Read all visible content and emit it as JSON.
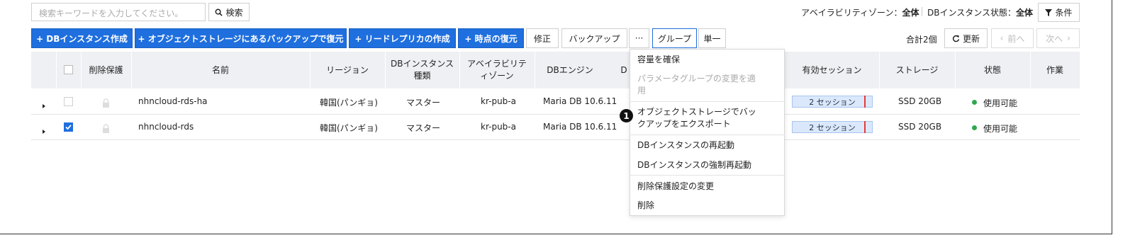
{
  "search": {
    "placeholder": "検索キーワードを入力してください。",
    "button_label": "検索"
  },
  "filters": {
    "az_label": "アベイラビリティゾーン：",
    "az_value": "全体",
    "state_label": "DBインスタンス状態：",
    "state_value": "全体",
    "condition_button": "条件"
  },
  "toolbar": {
    "create_instance": "+ DBインスタンス作成",
    "restore_from_storage": "+ オブジェクトストレージにあるバックアップで復元",
    "create_read_replica": "+ リードレプリカの作成",
    "point_in_time_restore": "+ 時点の復元",
    "modify": "修正",
    "backup": "バックアップ",
    "more": "···",
    "group": "グループ",
    "single": "単一",
    "total": "合計2個",
    "refresh": "更新",
    "prev": "前へ",
    "next": "次へ"
  },
  "table": {
    "headers": {
      "delete_protection": "削除保護",
      "name": "名前",
      "region": "リージョン",
      "instance_type": "DBインスタンス\n種類",
      "az": "アベイラビリテ\nィゾーン",
      "engine": "DBエンジン",
      "engine_partial": "D",
      "active_sessions": "有効セッション",
      "storage": "ストレージ",
      "status": "状態",
      "actions": "作業"
    },
    "rows": [
      {
        "name": "nhncloud-rds-ha",
        "region": "韓国(パンギョ)",
        "type": "マスター",
        "az": "kr-pub-a",
        "engine": "Maria DB 10.6.11",
        "sessions": "2 セッション",
        "storage": "SSD 20GB",
        "status": "使用可能",
        "checked": false
      },
      {
        "name": "nhncloud-rds",
        "region": "韓国(パンギョ)",
        "type": "マスター",
        "az": "kr-pub-a",
        "engine": "Maria DB 10.6.11",
        "sessions": "2 セッション",
        "storage": "SSD 20GB",
        "status": "使用可能",
        "checked": true
      }
    ]
  },
  "dropdown": {
    "items": [
      {
        "label": "容量を確保",
        "disabled": false
      },
      {
        "label": "パラメータグループの変更を適用",
        "disabled": true
      },
      {
        "label": "オブジェクトストレージでバックアップをエクスポート",
        "disabled": false
      },
      {
        "label": "DBインスタンスの再起動",
        "disabled": false
      },
      {
        "label": "DBインスタンスの強制再起動",
        "disabled": false
      },
      {
        "label": "削除保護設定の変更",
        "disabled": false
      },
      {
        "label": "削除",
        "disabled": false
      }
    ],
    "line1a": "パラメータグループの変更を適",
    "line1b": "用",
    "line2a": "オブジェクトストレージでバッ",
    "line2b": "クアップをエクスポート"
  },
  "annotation": {
    "badge": "1"
  },
  "colors": {
    "primary": "#1f6fde",
    "status_ok": "#2fa84f",
    "session_bar": "#dbe8fb",
    "session_mark": "#e23b3b",
    "header_bg": "#eef0f3"
  }
}
